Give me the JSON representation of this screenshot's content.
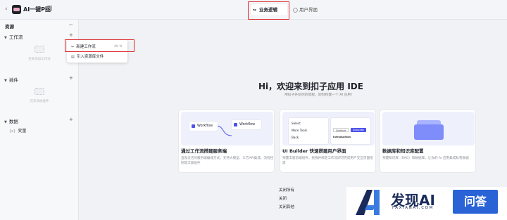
{
  "header": {
    "back_icon": "chevron-left-icon",
    "app_title": "AI一键P图",
    "tabs": [
      {
        "label": "业务逻辑",
        "icon": "logic-icon",
        "active": true
      },
      {
        "label": "用户界面",
        "icon": "ui-icon",
        "active": false
      }
    ]
  },
  "sidebar": {
    "title": "资源",
    "sections": [
      {
        "label": "工作流",
        "empty_text": "还未添加工作流"
      },
      {
        "label": "插件",
        "empty_text": "还未添加插件"
      },
      {
        "label": "数据",
        "items": [
          "变量"
        ]
      }
    ]
  },
  "menu": {
    "items": [
      {
        "label": "新建工作流",
        "shortcut": "Alt N"
      },
      {
        "label": "引入资源库文件"
      }
    ]
  },
  "main": {
    "welcome_title": "Hi，欢迎来到扣子应用 IDE",
    "welcome_subtitle": "用扣子开始你的旅程，即刻构建一个 AI 应用！",
    "cards": [
      {
        "title": "通过工作流搭建服务端",
        "desc": "直观灵活的服务端编排方式，支持大模型、三方API集成、流程控制等丰富组件",
        "thumb": {
          "node_a": "Workflow",
          "node_b": "Workflow"
        }
      },
      {
        "title": "UI Builder 快速搭建用户界面",
        "desc": "预置丰富前端组件，拖拽并绑定工作流即可完成用户交互页面搭建",
        "thumb": {
          "select": "Select",
          "more_tools": "More Tools",
          "back": "Back",
          "btn_a": "Continue",
          "btn_b": "Subscribe",
          "intro": "Introduction"
        }
      },
      {
        "title": "数据库和知识库配置",
        "desc": "预置知识库（RAG）和数据库，让你的 AI 应用集成私有数据"
      }
    ],
    "quick_links": [
      "关闭所有",
      "关闭",
      "关闭其他"
    ]
  },
  "watermark": {
    "brand": "发现AI",
    "domain": "FAXIANAI.COM",
    "badge": "问答"
  },
  "colors": {
    "accent": "#4d53e8",
    "highlight_box": "#e0282b"
  }
}
